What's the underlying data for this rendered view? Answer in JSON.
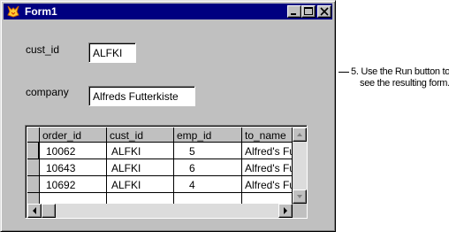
{
  "window": {
    "title": "Form1",
    "icon": "foxpro-fox-icon"
  },
  "fields": [
    {
      "label": "cust_id",
      "value": "ALFKI"
    },
    {
      "label": "company",
      "value": "Alfreds Futterkiste"
    }
  ],
  "grid": {
    "columns": [
      "order_id",
      "cust_id",
      "emp_id",
      "to_name"
    ],
    "rows": [
      [
        "10062",
        "ALFKI",
        "5",
        "Alfred's Fu"
      ],
      [
        "10643",
        "ALFKI",
        "6",
        "Alfred's Fu"
      ],
      [
        "10692",
        "ALFKI",
        "4",
        "Alfred's Fu"
      ]
    ]
  },
  "callout": {
    "line1": "5. Use the  Run button to",
    "line2": "see the resulting form."
  },
  "colors": {
    "titlebar": "#000080",
    "face": "#c0c0c0"
  }
}
